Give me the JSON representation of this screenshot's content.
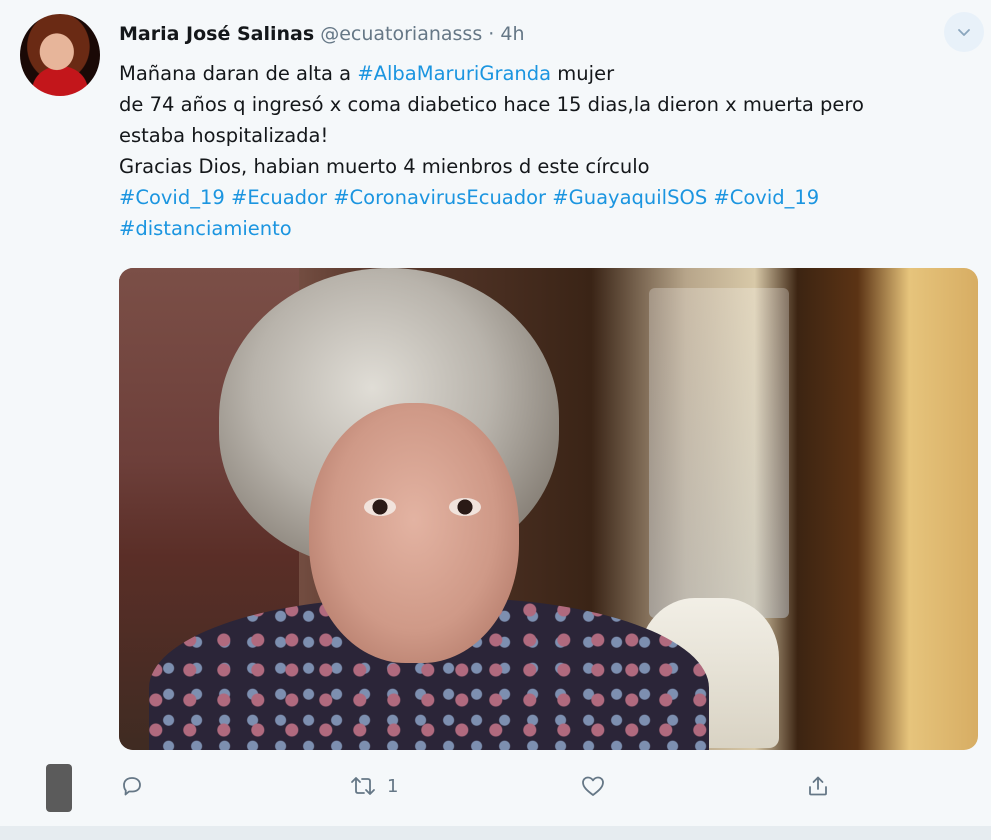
{
  "tweet": {
    "author_name": "Maria José Salinas",
    "author_handle": "@ecuatorianasss",
    "separator": "·",
    "time": "4h",
    "line1_prefix": "Mañana daran de alta a ",
    "line1_hashtag": "#AlbaMaruriGranda",
    "line1_suffix": " mujer",
    "line2": "de 74 años q ingresó x coma diabetico hace 15 dias,la dieron x muerta pero",
    "line3": "estaba hospitalizada!",
    "line4": "Gracias Dios, habian muerto 4 mienbros d este círculo",
    "hashtags_line5": "#Covid_19 #Ecuador #CoronavirusEcuador #GuayaquilSOS #Covid_19",
    "hashtags_line6": "#distanciamiento",
    "retweet_count": "1"
  },
  "icons": {
    "caret": "chevron-down-icon",
    "reply": "reply-icon",
    "retweet": "retweet-icon",
    "like": "heart-icon",
    "share": "share-icon"
  },
  "colors": {
    "link": "#1b95e0",
    "muted": "#657786",
    "background": "#f5f8fa"
  }
}
